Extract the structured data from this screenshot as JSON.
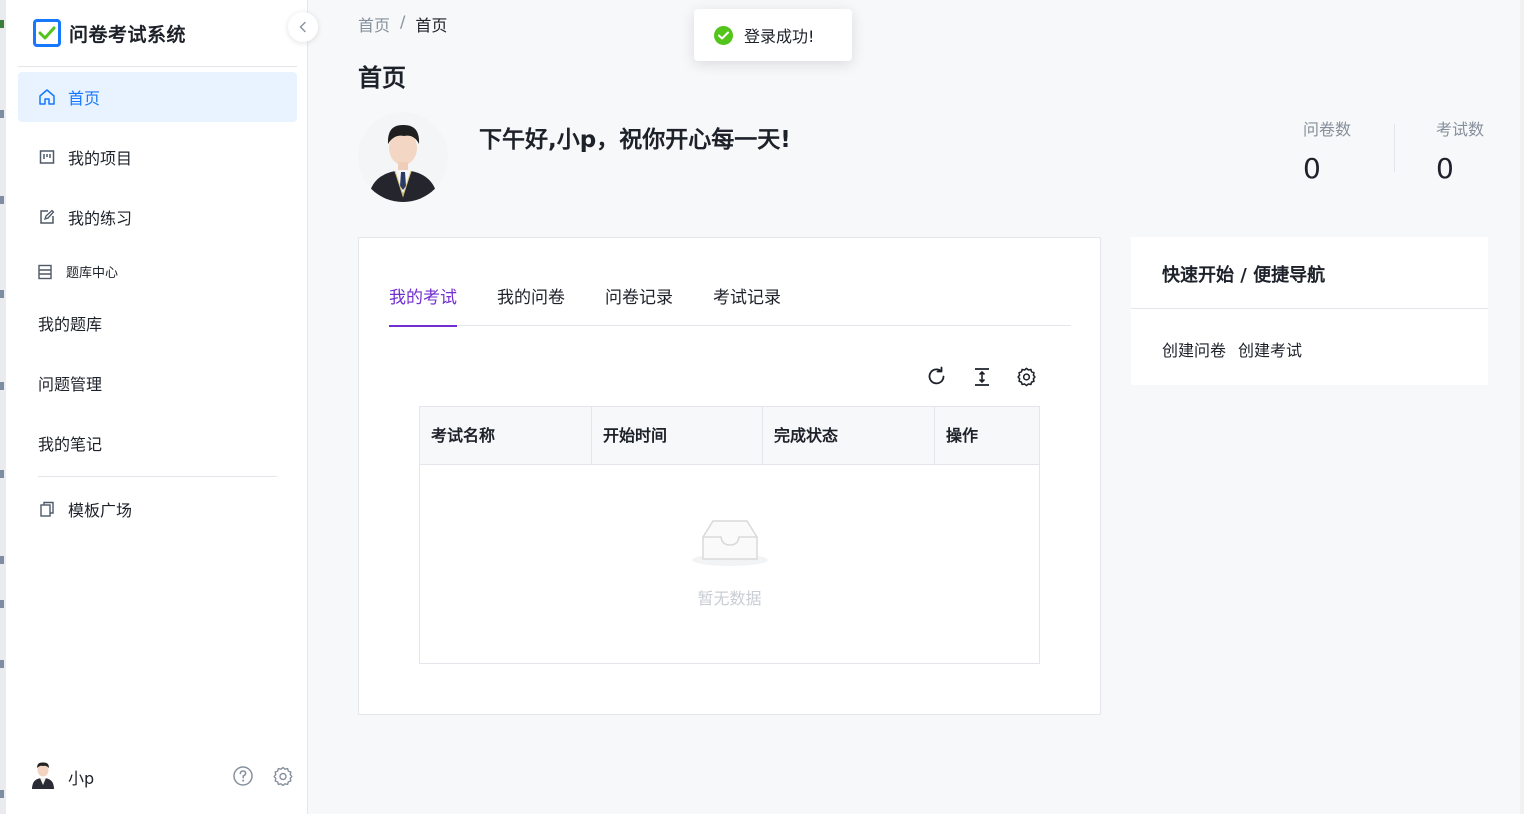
{
  "app": {
    "title": "问卷考试系统"
  },
  "sidebar": {
    "items": [
      {
        "label": "首页",
        "icon": "home-icon"
      },
      {
        "label": "我的项目",
        "icon": "project-icon"
      },
      {
        "label": "我的练习",
        "icon": "edit-icon"
      }
    ],
    "group_label": "题库中心",
    "sub_items": [
      "我的题库",
      "问题管理",
      "我的笔记"
    ],
    "template_item": "模板广场"
  },
  "user": {
    "name": "小p"
  },
  "breadcrumb": {
    "root": "首页",
    "sep": "/",
    "current": "首页"
  },
  "page": {
    "title": "首页"
  },
  "hero": {
    "greeting": "下午好,小p，祝你开心每一天!",
    "stats": [
      {
        "label": "问卷数",
        "value": "0"
      },
      {
        "label": "考试数",
        "value": "0"
      }
    ]
  },
  "tabs": [
    "我的考试",
    "我的问卷",
    "问卷记录",
    "考试记录"
  ],
  "table": {
    "columns": [
      "考试名称",
      "开始时间",
      "完成状态",
      "操作"
    ],
    "empty_text": "暂无数据"
  },
  "quick": {
    "title": "快速开始 / 便捷导航",
    "links": [
      "创建问卷",
      "创建考试"
    ]
  },
  "toast": {
    "message": "登录成功!"
  },
  "colors": {
    "primary": "#1677ff",
    "tab_active": "#722ed1",
    "success": "#52c41a"
  }
}
